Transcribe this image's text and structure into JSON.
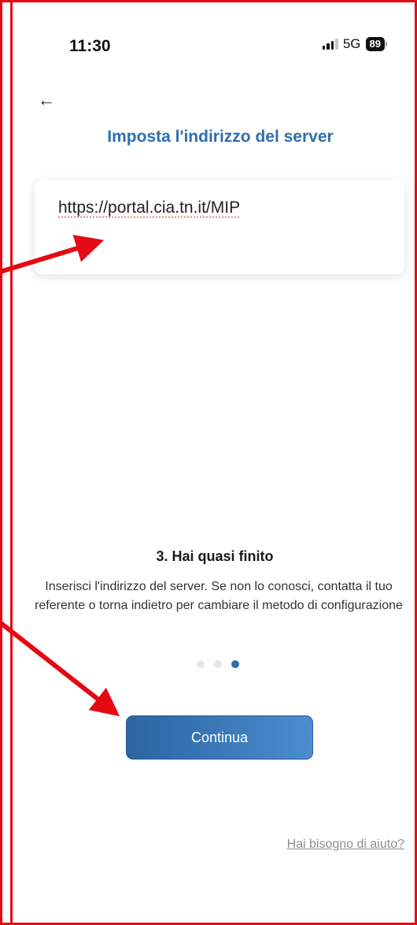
{
  "status_bar": {
    "time": "11:30",
    "network": "5G",
    "battery": "89"
  },
  "header": {
    "title": "Imposta l'indirizzo del server"
  },
  "server": {
    "value": "https://portal.cia.tn.it/MIP"
  },
  "onboarding": {
    "step_title": "3. Hai quasi finito",
    "description": "Inserisci l'indirizzo del server. Se non lo conosci, contatta il tuo referente o torna indietro per cambiare il metodo di configurazione",
    "current_step": 3,
    "total_steps": 3
  },
  "actions": {
    "continue_label": "Continua",
    "help_label": "Hai bisogno di aiuto?"
  },
  "colors": {
    "accent": "#2e6fae",
    "annotation": "#e50914"
  }
}
